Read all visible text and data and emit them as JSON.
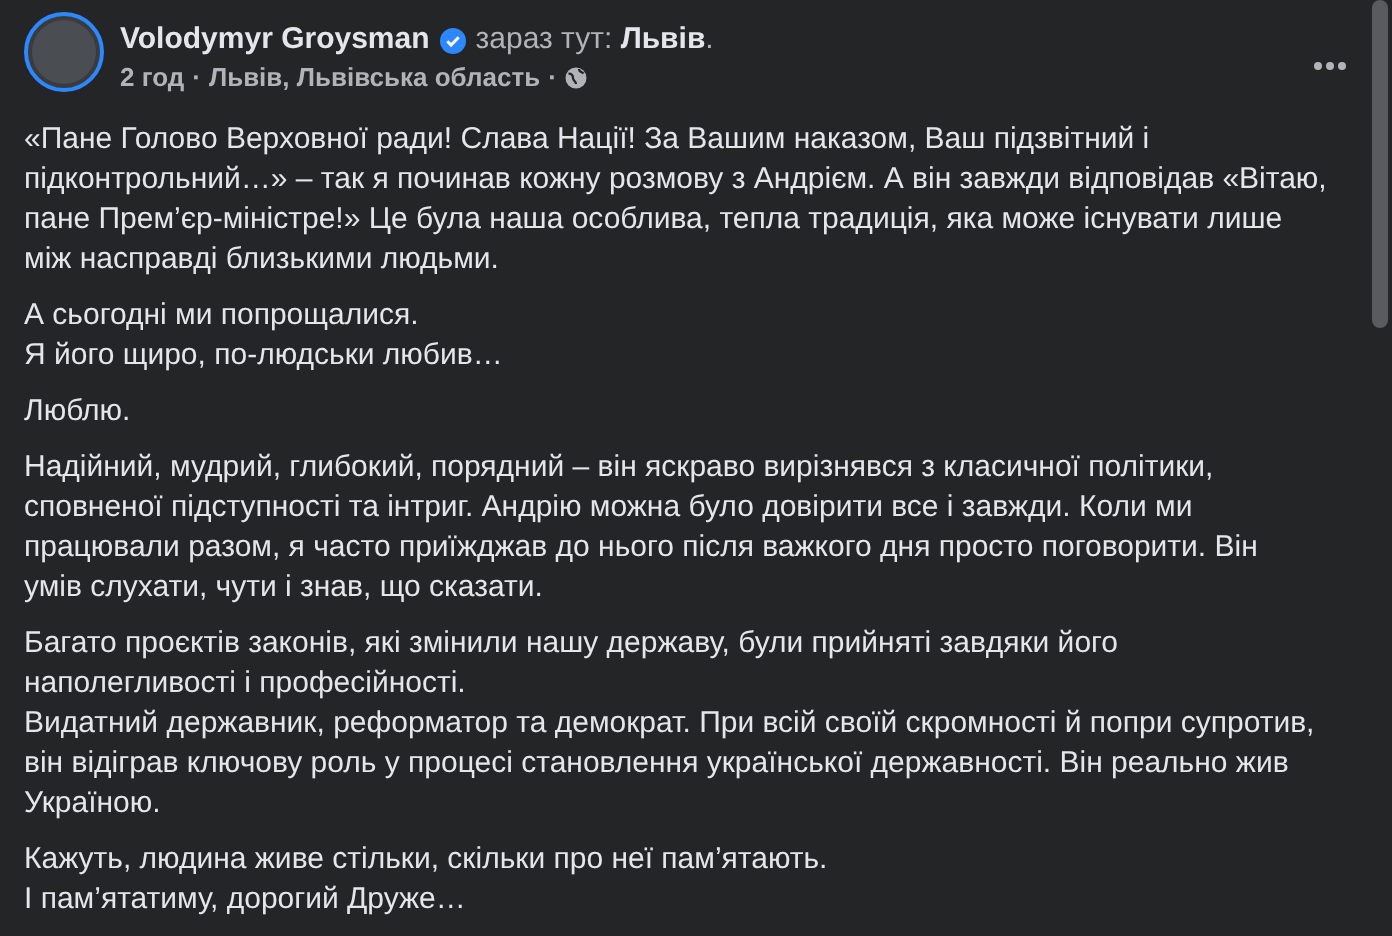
{
  "post": {
    "author": "Volodymyr Groysman",
    "verified": true,
    "checkin_prefix": "зараз тут:",
    "checkin_place": "Львів",
    "checkin_end": ".",
    "time": "2 год",
    "separator_1": "·",
    "location": "Львів, Львівська область",
    "separator_2": "·",
    "paragraphs": [
      [
        "«Пане Голово Верховної ради! Слава Нації! За Вашим наказом, Ваш підзвітний і",
        "підконтрольний…» – так я починав кожну розмову з Андрієм. А він завжди відповідав «Вітаю,",
        "пане Прем’єр-міністре!» Це була наша особлива, тепла традиція, яка може існувати лише",
        "між насправді близькими людьми."
      ],
      [
        "А сьогодні ми попрощалися.",
        "Я його щиро, по-людськи любив…"
      ],
      [
        "Люблю."
      ],
      [
        "Надійний, мудрий, глибокий, порядний – він яскраво вирізнявся з класичної політики,",
        "сповненої підступності та інтриг. Андрію можна було довірити все і завжди. Коли ми",
        "працювали разом, я часто приїжджав до нього після важкого дня просто поговорити. Він",
        "умів слухати, чути і знав, що сказати."
      ],
      [
        "Багато проєктів законів, які змінили нашу державу, були прийняті завдяки його",
        "наполегливості і професійності.",
        "Видатний державник, реформатор та демократ. При всій своїй скромності й попри супротив,",
        "він відіграв ключову роль у процесі становлення української державності. Він реально жив",
        "Україною."
      ],
      [
        "Кажуть, людина живе стільки, скільки про неї пам’ятають.",
        "І пам’ятатиму, дорогий Друже…"
      ]
    ]
  }
}
